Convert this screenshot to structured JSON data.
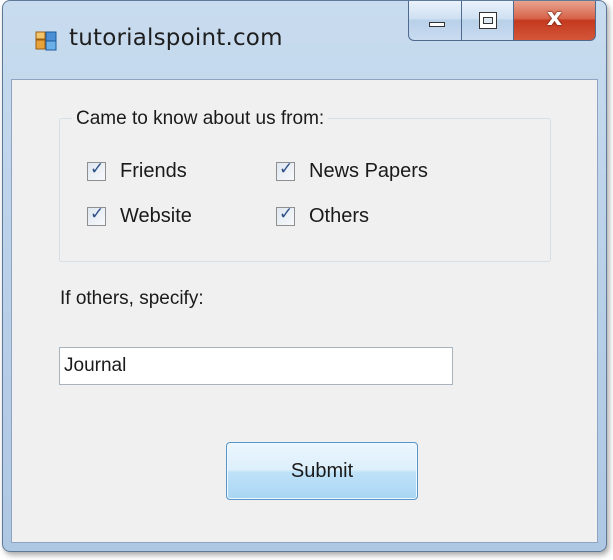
{
  "window": {
    "title": "tutorialspoint.com",
    "close_glyph": "x"
  },
  "group": {
    "legend": "Came to know about us from:",
    "options": [
      {
        "label": "Friends",
        "checked": true
      },
      {
        "label": "News Papers",
        "checked": true
      },
      {
        "label": "Website",
        "checked": true
      },
      {
        "label": "Others",
        "checked": true
      }
    ]
  },
  "specify": {
    "label": "If others, specify:",
    "value": "Journal"
  },
  "submit": {
    "label": "Submit"
  },
  "colors": {
    "titlebar": "#b8cfe8",
    "client": "#f0f0f0",
    "close_button": "#c4391e",
    "button_face": "#bfe2f8"
  },
  "icons": {
    "app": "windows-form-icon",
    "minimize": "minimize-icon",
    "maximize": "maximize-icon",
    "close": "close-icon",
    "check": "check-icon"
  }
}
